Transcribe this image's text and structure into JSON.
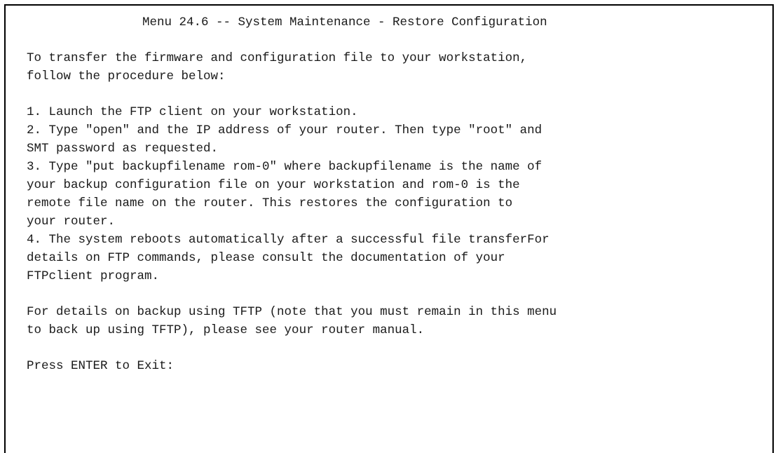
{
  "screen": {
    "title": "Menu 24.6 -- System Maintenance - Restore Configuration",
    "intro": [
      "To transfer the firmware and configuration file to your workstation,",
      "follow the procedure below:"
    ],
    "steps": [
      "1. Launch the FTP client on your workstation.",
      "2. Type \"open\" and the IP address of your router. Then type \"root\" and",
      "SMT password as requested.",
      "3. Type \"put backupfilename rom-0\" where backupfilename is the name of",
      "your backup configuration file on your workstation and rom-0 is the",
      "remote file name on the router. This restores the configuration to",
      "your router.",
      "4. The system reboots automatically after a successful file transferFor",
      "details on FTP commands, please consult the documentation of your",
      "FTPclient program."
    ],
    "tftp_note": [
      "For details on backup using TFTP (note that you must remain in this menu",
      "to back up using TFTP), please see your router manual."
    ],
    "prompt": "Press ENTER to Exit:"
  }
}
